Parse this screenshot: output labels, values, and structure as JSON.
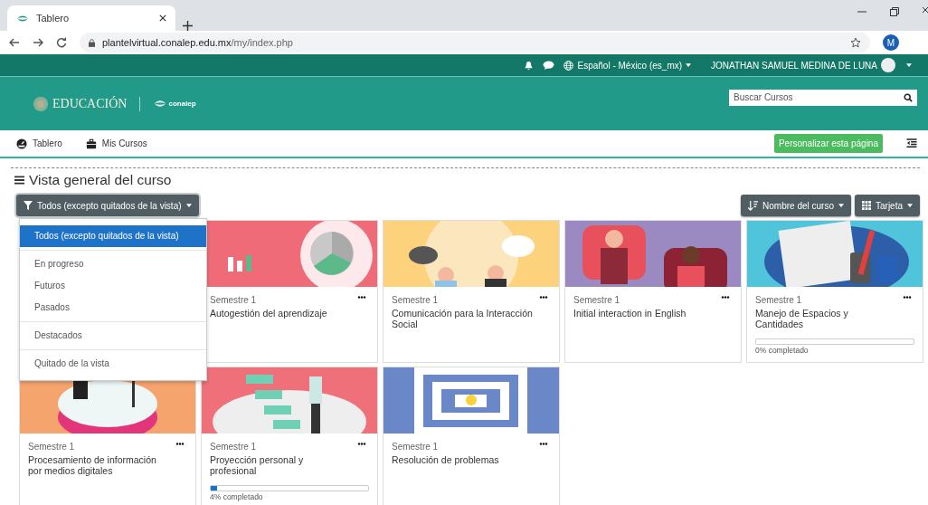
{
  "browser": {
    "tab_title": "Tablero",
    "url_host": "plantelvirtual.conalep.edu.mx",
    "url_path": "/my/index.php",
    "profile_initial": "M"
  },
  "navbar": {
    "language": "Español - México (es_mx)",
    "user": "JONATHAN SAMUEL MEDINA DE LUNA"
  },
  "header": {
    "logo_text": "EDUCACIÓN",
    "brand": "conalep",
    "search": {
      "placeholder": "Buscar Cursos"
    }
  },
  "nav": {
    "items": [
      "Tablero",
      "Mis Cursos"
    ],
    "customize_button": "Personalizar esta página"
  },
  "course_overview": {
    "title": "Vista general del curso",
    "filter": {
      "label": "Todos (excepto quitados de la vista)",
      "expanded": true,
      "option_groups": [
        {
          "options": [
            {
              "label": "Todos (excepto quitados de la vista)",
              "selected": true
            }
          ]
        },
        {
          "options": [
            {
              "label": "En progreso",
              "selected": false
            },
            {
              "label": "Futuros",
              "selected": false
            },
            {
              "label": "Pasados",
              "selected": false
            }
          ]
        },
        {
          "options": [
            {
              "label": "Destacados",
              "selected": false
            }
          ]
        },
        {
          "options": [
            {
              "label": "Quitado de la vista",
              "selected": false
            }
          ]
        }
      ]
    },
    "sort": "Nombre del curso",
    "view": "Tarjeta",
    "courses": [
      {
        "semester": "Semestre 1",
        "title": "Autogestión del aprendizaje"
      },
      {
        "semester": "Semestre 1",
        "title": "Comunicación para la Interacción Social"
      },
      {
        "semester": "Semestre 1",
        "title": "Initial interaction in English"
      },
      {
        "semester": "Semestre 1",
        "title": "Manejo de Espacios y Cantidades",
        "progress": {
          "level": 0,
          "label": "0% completado"
        }
      },
      {
        "semester": "Semestre 1",
        "title": "Procesamiento de información por medios digitales"
      },
      {
        "semester": "Semestre 1",
        "title": "Proyección personal y profesional",
        "progress": {
          "level": 0.04,
          "label": "4% completado"
        }
      },
      {
        "semester": "Semestre 1",
        "title": "Resolución de problemas"
      }
    ]
  }
}
